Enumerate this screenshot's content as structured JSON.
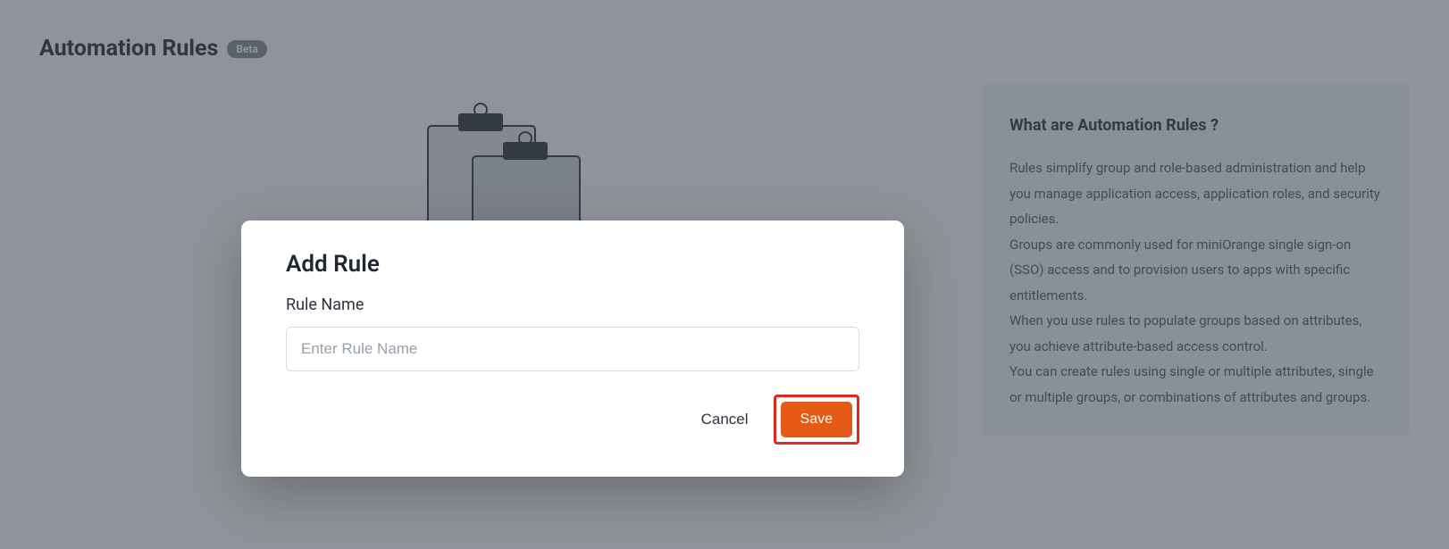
{
  "header": {
    "title": "Automation Rules",
    "badge": "Beta"
  },
  "info_panel": {
    "title": "What are Automation Rules ?",
    "paragraphs": [
      "Rules simplify group and role-based administration and help you manage application access, application roles, and security policies.",
      "Groups are commonly used for miniOrange single sign-on (SSO) access and to provision users to apps with specific entitlements.",
      "When you use rules to populate groups based on attributes, you achieve attribute-based access control.",
      "You can create rules using single or multiple attributes, single or multiple groups, or combinations of attributes and groups."
    ]
  },
  "modal": {
    "title": "Add Rule",
    "field_label": "Rule Name",
    "placeholder": "Enter Rule Name",
    "cancel": "Cancel",
    "save": "Save"
  }
}
